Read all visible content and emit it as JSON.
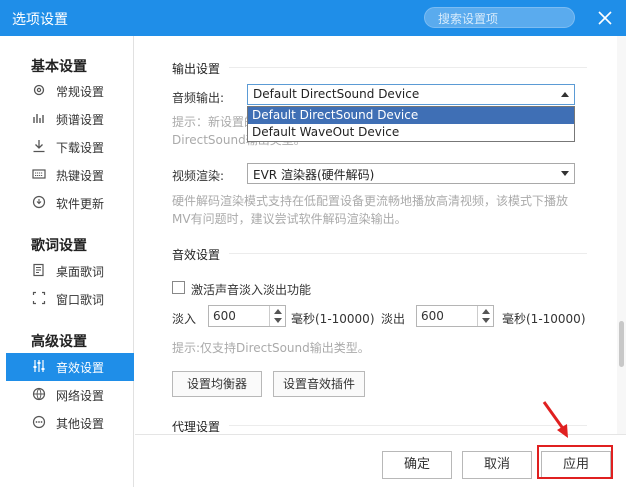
{
  "window": {
    "title": "选项设置",
    "search_placeholder": "搜索设置项"
  },
  "sidebar": {
    "groups": [
      {
        "title": "基本设置",
        "items": [
          {
            "label": "常规设置",
            "icon": "gear-icon"
          },
          {
            "label": "频谱设置",
            "icon": "spectrum-icon"
          },
          {
            "label": "下载设置",
            "icon": "download-icon"
          },
          {
            "label": "热键设置",
            "icon": "keyboard-icon"
          },
          {
            "label": "软件更新",
            "icon": "update-icon"
          }
        ]
      },
      {
        "title": "歌词设置",
        "items": [
          {
            "label": "桌面歌词",
            "icon": "desktop-lyrics-icon"
          },
          {
            "label": "窗口歌词",
            "icon": "window-lyrics-icon"
          }
        ]
      },
      {
        "title": "高级设置",
        "items": [
          {
            "label": "音效设置",
            "icon": "equalizer-icon",
            "active": true
          },
          {
            "label": "网络设置",
            "icon": "network-icon"
          },
          {
            "label": "其他设置",
            "icon": "more-icon"
          }
        ]
      }
    ]
  },
  "output": {
    "title": "输出设置",
    "audio_label": "音频输出:",
    "audio_selected": "Default DirectSound Device",
    "audio_options": [
      "Default DirectSound Device",
      "Default WaveOut Device"
    ],
    "hint_line1": "提示：新设置的",
    "hint_line2": "DirectSound输出类型。",
    "video_label": "视频渲染:",
    "video_selected": "EVR 渲染器(硬件解码)",
    "video_hint_line1": "硬件解码渲染模式支持在低配置设备更流畅地播放高清视频，该模式下播放",
    "video_hint_line2": "MV有问题时，建议尝试软件解码渲染输出。"
  },
  "effects": {
    "title": "音效设置",
    "fade_checkbox_label": "激活声音淡入淡出功能",
    "fade_in_label": "淡入",
    "fade_in_value": "600",
    "fade_in_unit": "毫秒(1-10000)",
    "fade_out_label": "淡出",
    "fade_out_value": "600",
    "fade_out_unit": "毫秒(1-10000)",
    "hint": "提示:仅支持DirectSound输出类型。",
    "equalizer_button": "设置均衡器",
    "plugin_button": "设置音效插件"
  },
  "proxy": {
    "title": "代理设置"
  },
  "footer": {
    "ok": "确定",
    "cancel": "取消",
    "apply": "应用"
  },
  "colors": {
    "accent": "#1f8ee8",
    "highlight": "#e02020"
  }
}
